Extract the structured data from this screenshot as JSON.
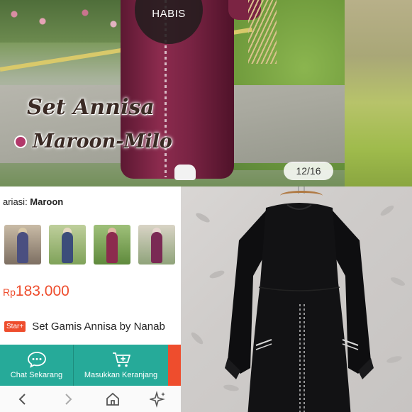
{
  "hero": {
    "badge": "HABIS",
    "title_line1": "Set Annisa",
    "title_line2": "Maroon-Milo",
    "counter": "12/16"
  },
  "panel": {
    "variasi_label": "ariasi: ",
    "variasi_value": "Maroon",
    "price_currency": "Rp",
    "price_amount": "183.000",
    "star_badge": "Star+",
    "product_title": "Set Gamis Annisa by Nanab"
  },
  "actions": {
    "chat_label": "Chat Sekarang",
    "chat_icon": "chat-bubble-icon",
    "cart_label": "Masukkan Keranjang",
    "cart_icon": "add-to-cart-icon"
  },
  "nav": {
    "icons": [
      "back-chevron-icon",
      "forward-chevron-icon",
      "home-icon",
      "sparkle-icon"
    ]
  },
  "colors": {
    "accent": "#ee4d2d",
    "action_teal": "#26aa99",
    "maroon": "#8c2b4e"
  }
}
